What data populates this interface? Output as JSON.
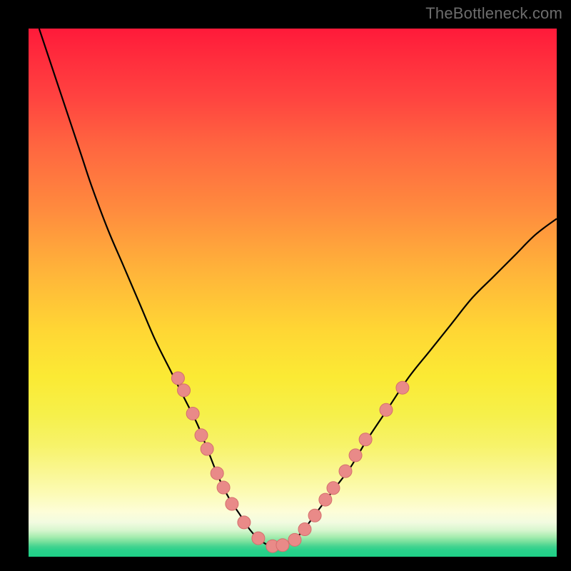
{
  "watermark": {
    "text": "TheBottleneck.com"
  },
  "colors": {
    "curve": "#000000",
    "dot_fill": "#e98a88",
    "dot_stroke": "#d46f6d",
    "green": "#1ecf86",
    "red": "#ff1a3a"
  },
  "chart_data": {
    "type": "line",
    "title": "",
    "xlabel": "",
    "ylabel": "",
    "xlim": [
      0,
      100
    ],
    "ylim": [
      0,
      100
    ],
    "grid": false,
    "series": [
      {
        "name": "bottleneck-curve",
        "x": [
          2,
          4,
          6,
          8,
          10,
          12,
          15,
          18,
          21,
          24,
          27,
          29.5,
          32,
          34,
          36,
          38,
          40,
          42,
          44,
          46,
          48,
          50,
          52,
          55,
          58,
          61,
          64,
          68,
          72,
          76,
          80,
          84,
          88,
          92,
          96,
          100
        ],
        "y": [
          100,
          94,
          88,
          82,
          76,
          70,
          62,
          55,
          48,
          41,
          35,
          30,
          25,
          20,
          15,
          11,
          8,
          5,
          3,
          2,
          2.2,
          3,
          5,
          9,
          13,
          17,
          22,
          28,
          34,
          39,
          44,
          49,
          53,
          57,
          61,
          64
        ]
      }
    ],
    "markers": [
      {
        "name": "left-cluster",
        "x": 28.3,
        "y": 33.8
      },
      {
        "name": "left-cluster",
        "x": 29.4,
        "y": 31.5
      },
      {
        "name": "left-cluster",
        "x": 31.1,
        "y": 27.1
      },
      {
        "name": "left-cluster",
        "x": 32.7,
        "y": 23.0
      },
      {
        "name": "left-cluster",
        "x": 33.8,
        "y": 20.4
      },
      {
        "name": "left-cluster",
        "x": 35.7,
        "y": 15.8
      },
      {
        "name": "left-cluster",
        "x": 36.9,
        "y": 13.1
      },
      {
        "name": "left-cluster",
        "x": 38.5,
        "y": 10.0
      },
      {
        "name": "valley",
        "x": 40.8,
        "y": 6.5
      },
      {
        "name": "valley",
        "x": 43.5,
        "y": 3.5
      },
      {
        "name": "valley",
        "x": 46.2,
        "y": 2.0
      },
      {
        "name": "valley",
        "x": 48.1,
        "y": 2.2
      },
      {
        "name": "valley",
        "x": 50.4,
        "y": 3.2
      },
      {
        "name": "valley",
        "x": 52.3,
        "y": 5.2
      },
      {
        "name": "valley",
        "x": 54.2,
        "y": 7.8
      },
      {
        "name": "valley",
        "x": 56.2,
        "y": 10.8
      },
      {
        "name": "right-cluster",
        "x": 57.7,
        "y": 13.0
      },
      {
        "name": "right-cluster",
        "x": 60.0,
        "y": 16.2
      },
      {
        "name": "right-cluster",
        "x": 61.9,
        "y": 19.2
      },
      {
        "name": "right-cluster",
        "x": 63.8,
        "y": 22.2
      },
      {
        "name": "right-cluster",
        "x": 67.7,
        "y": 27.8
      },
      {
        "name": "right-cluster",
        "x": 70.8,
        "y": 32.0
      }
    ]
  }
}
